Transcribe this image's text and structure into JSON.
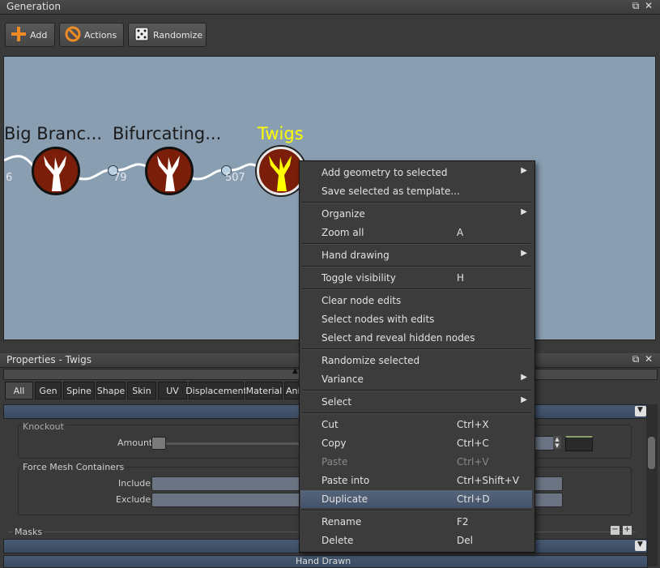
{
  "generation_panel": {
    "title": "Generation",
    "toolbar": {
      "add": "Add",
      "actions": "Actions",
      "randomize": "Randomize"
    },
    "nodes": [
      {
        "title": "Big Branc...",
        "count_left": "6"
      },
      {
        "title": "Bifurcating...",
        "count_left": "79"
      },
      {
        "title": "Twigs",
        "count_left": "507"
      }
    ],
    "colors": {
      "canvas": "#8a9eb2",
      "selected_title": "#ffff00",
      "node_fill": "#7a1e0a"
    }
  },
  "properties_panel": {
    "title": "Properties - Twigs",
    "tabs": [
      "All",
      "Gen",
      "Spine",
      "Shape",
      "Skin",
      "UV",
      "Displacement",
      "Material",
      "Ani"
    ],
    "knockout": {
      "group": "Knockout",
      "amount_label": "Amount"
    },
    "force_mesh": {
      "group": "Force Mesh Containers",
      "include": "Include",
      "exclude": "Exclude"
    },
    "masks": "Masks",
    "hand_drawn": "Hand Drawn"
  },
  "context_menu": {
    "items": [
      {
        "label": "Add geometry to selected",
        "submenu": true
      },
      {
        "label": "Save selected as template..."
      },
      {
        "label": "Organize",
        "submenu": true
      },
      {
        "label": "Zoom all",
        "shortcut": "A"
      },
      {
        "label": "Hand drawing",
        "submenu": true
      },
      {
        "label": "Toggle visibility",
        "shortcut": "H"
      },
      {
        "label": "Clear node edits"
      },
      {
        "label": "Select nodes with edits"
      },
      {
        "label": "Select and reveal hidden nodes"
      },
      {
        "label": "Randomize selected"
      },
      {
        "label": "Variance",
        "submenu": true
      },
      {
        "label": "Select",
        "submenu": true
      },
      {
        "label": "Cut",
        "shortcut": "Ctrl+X"
      },
      {
        "label": "Copy",
        "shortcut": "Ctrl+C"
      },
      {
        "label": "Paste",
        "shortcut": "Ctrl+V",
        "disabled": true
      },
      {
        "label": "Paste into",
        "shortcut": "Ctrl+Shift+V"
      },
      {
        "label": "Duplicate",
        "shortcut": "Ctrl+D",
        "highlighted": true
      },
      {
        "label": "Rename",
        "shortcut": "F2"
      },
      {
        "label": "Delete",
        "shortcut": "Del"
      }
    ]
  }
}
